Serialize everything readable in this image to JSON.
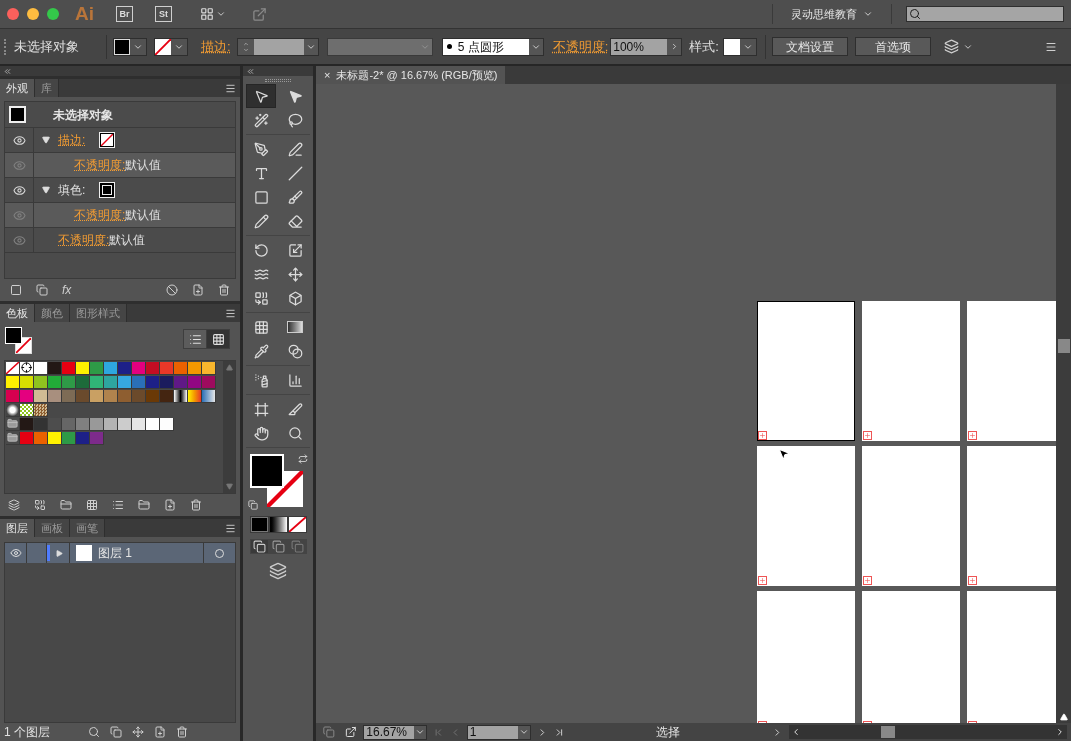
{
  "title_bar": {
    "app_logo": "Ai",
    "app_buttons": [
      "Br",
      "St"
    ],
    "workspace": "灵动思维教育"
  },
  "control_bar": {
    "selection": "未选择对象",
    "stroke_label": "描边:",
    "brush": "5 点圆形",
    "opacity_label": "不透明度:",
    "opacity": "100%",
    "style_label": "样式:",
    "buttons": [
      "文档设置",
      "首选项"
    ]
  },
  "appearance_panel": {
    "tabs": [
      {
        "label": "外观",
        "selected": true
      },
      {
        "label": "库",
        "selected": false
      }
    ],
    "title": "未选择对象",
    "items": [
      {
        "kind": "stroke",
        "label": "描边:",
        "link": true,
        "visible": true,
        "expanded": true,
        "children": [
          {
            "label": "不透明度:",
            "value": "默认值",
            "visible": false
          }
        ]
      },
      {
        "kind": "fill",
        "label": "填色:",
        "link": false,
        "visible": true,
        "expanded": true,
        "children": [
          {
            "label": "不透明度:",
            "value": "默认值",
            "visible": false
          }
        ]
      },
      {
        "label": "不透明度:",
        "link": true,
        "value": "默认值",
        "visible": false
      }
    ],
    "fx_button": "fx"
  },
  "swatches_panel": {
    "tabs": [
      {
        "label": "色板",
        "selected": true
      },
      {
        "label": "颜色",
        "selected": false
      },
      {
        "label": "图形样式",
        "selected": false
      }
    ],
    "view_buttons": [
      {
        "kind": "list",
        "selected": false
      },
      {
        "kind": "grid",
        "selected": true
      }
    ],
    "rows": [
      [
        {
          "kind": "none"
        },
        {
          "kind": "registration"
        },
        {
          "kind": "color",
          "color": "#ffffff"
        },
        {
          "kind": "color",
          "color": "#231815"
        },
        {
          "kind": "color",
          "color": "#e60012"
        },
        {
          "kind": "color",
          "color": "#fff100"
        },
        {
          "kind": "color",
          "color": "#2e9a47"
        },
        {
          "kind": "color",
          "color": "#2ea7e0"
        },
        {
          "kind": "color",
          "color": "#1d2088"
        },
        {
          "kind": "color",
          "color": "#e4007f"
        },
        {
          "kind": "color",
          "color": "#c30d23"
        },
        {
          "kind": "color",
          "color": "#e83828"
        },
        {
          "kind": "color",
          "color": "#eb6100"
        },
        {
          "kind": "color",
          "color": "#f39800"
        },
        {
          "kind": "color",
          "color": "#f8b62d"
        }
      ],
      [
        {
          "kind": "color",
          "color": "#fff100"
        },
        {
          "kind": "color",
          "color": "#d7df01"
        },
        {
          "kind": "color",
          "color": "#8fc31f"
        },
        {
          "kind": "color",
          "color": "#22ac38"
        },
        {
          "kind": "color",
          "color": "#2e9a47"
        },
        {
          "kind": "color",
          "color": "#1d6b3a"
        },
        {
          "kind": "color",
          "color": "#30b477"
        },
        {
          "kind": "color",
          "color": "#2ea5a0"
        },
        {
          "kind": "color",
          "color": "#36a8e1"
        },
        {
          "kind": "color",
          "color": "#2a6fb8"
        },
        {
          "kind": "color",
          "color": "#1d2088"
        },
        {
          "kind": "color",
          "color": "#1b1c5e"
        },
        {
          "kind": "color",
          "color": "#601986"
        },
        {
          "kind": "color",
          "color": "#920783"
        },
        {
          "kind": "color",
          "color": "#9e0b5e"
        }
      ],
      [
        {
          "kind": "color",
          "color": "#d7004f"
        },
        {
          "kind": "color",
          "color": "#e4007f"
        },
        {
          "kind": "color",
          "color": "#d0bb94"
        },
        {
          "kind": "color",
          "color": "#a88f7e"
        },
        {
          "kind": "color",
          "color": "#7d6b55"
        },
        {
          "kind": "color",
          "color": "#6a4a2c"
        },
        {
          "kind": "color",
          "color": "#c9a063"
        },
        {
          "kind": "color",
          "color": "#b0834d"
        },
        {
          "kind": "color",
          "color": "#8e5e30"
        },
        {
          "kind": "color",
          "color": "#6b4a2b"
        },
        {
          "kind": "color",
          "color": "#6a3906"
        },
        {
          "kind": "color",
          "color": "#442511"
        },
        {
          "kind": "gradient_bw"
        },
        {
          "kind": "gradient_orange"
        },
        {
          "kind": "gradient_blue"
        }
      ],
      [
        {
          "kind": "pattern_dots"
        },
        {
          "kind": "pattern_leaves"
        },
        {
          "kind": "pattern_wood"
        }
      ],
      [
        {
          "kind": "folder"
        },
        {
          "kind": "color",
          "color": "#231815"
        },
        {
          "kind": "color",
          "color": "#333333"
        },
        {
          "kind": "color",
          "color": "#4d4d4d"
        },
        {
          "kind": "color",
          "color": "#666666"
        },
        {
          "kind": "color",
          "color": "#808080"
        },
        {
          "kind": "color",
          "color": "#999999"
        },
        {
          "kind": "color",
          "color": "#b3b3b3"
        },
        {
          "kind": "color",
          "color": "#cccccc"
        },
        {
          "kind": "color",
          "color": "#e6e6e6"
        },
        {
          "kind": "color",
          "color": "#fefefe"
        },
        {
          "kind": "color",
          "color": "#fdfdfd"
        }
      ],
      [
        {
          "kind": "folder"
        },
        {
          "kind": "color",
          "color": "#e60012"
        },
        {
          "kind": "color",
          "color": "#eb6100"
        },
        {
          "kind": "color",
          "color": "#fff100"
        },
        {
          "kind": "color",
          "color": "#2e9a47"
        },
        {
          "kind": "color",
          "color": "#1d2088"
        },
        {
          "kind": "color",
          "color": "#7d2b8b"
        }
      ]
    ]
  },
  "layers_panel": {
    "tabs": [
      {
        "label": "图层",
        "selected": true
      },
      {
        "label": "画板",
        "selected": false
      },
      {
        "label": "画笔",
        "selected": false
      }
    ],
    "layers": [
      {
        "name": "图层 1",
        "visible": true,
        "expanded": false,
        "selected": true
      }
    ],
    "footer": "1 个图层"
  },
  "tools": [
    [
      {
        "kind": "selection",
        "selected": true
      },
      {
        "kind": "direct",
        "selected": false
      },
      {
        "kind": "magic",
        "selected": false
      },
      {
        "kind": "lasso",
        "selected": false
      }
    ],
    [
      {
        "kind": "pen",
        "selected": false
      },
      {
        "kind": "curvature",
        "selected": false
      },
      {
        "kind": "type",
        "selected": false
      },
      {
        "kind": "line",
        "selected": false
      },
      {
        "kind": "rect",
        "selected": false
      },
      {
        "kind": "brush",
        "selected": false
      },
      {
        "kind": "pencil",
        "selected": false
      },
      {
        "kind": "eraser",
        "selected": false
      }
    ],
    [
      {
        "kind": "rotate",
        "selected": false
      },
      {
        "kind": "scale",
        "selected": false
      },
      {
        "kind": "warp",
        "selected": false
      },
      {
        "kind": "transform",
        "selected": false
      },
      {
        "kind": "shapebuilder",
        "selected": false
      },
      {
        "kind": "perspective",
        "selected": false
      }
    ],
    [
      {
        "kind": "mesh",
        "selected": false
      },
      {
        "kind": "gradient",
        "selected": false
      },
      {
        "kind": "eyedropper",
        "selected": false
      },
      {
        "kind": "blend",
        "selected": false
      }
    ],
    [
      {
        "kind": "symbol",
        "selected": false
      },
      {
        "kind": "graph",
        "selected": false
      }
    ],
    [
      {
        "kind": "artboard",
        "selected": false
      },
      {
        "kind": "slice",
        "selected": false
      },
      {
        "kind": "hand",
        "selected": false
      },
      {
        "kind": "zoom",
        "selected": false
      }
    ]
  ],
  "document": {
    "tab": {
      "close": "×",
      "title": "未标题-2* @ 16.67% (RGB/预览)"
    },
    "artboards": [
      {
        "selected": true
      },
      {
        "selected": false
      },
      {
        "selected": false
      },
      {
        "selected": false
      },
      {
        "selected": false
      },
      {
        "selected": false
      },
      {
        "selected": false
      },
      {
        "selected": false
      },
      {
        "selected": false
      }
    ]
  },
  "status_bar": {
    "zoom": "16.67%",
    "artboard": "1",
    "status": "选择"
  }
}
